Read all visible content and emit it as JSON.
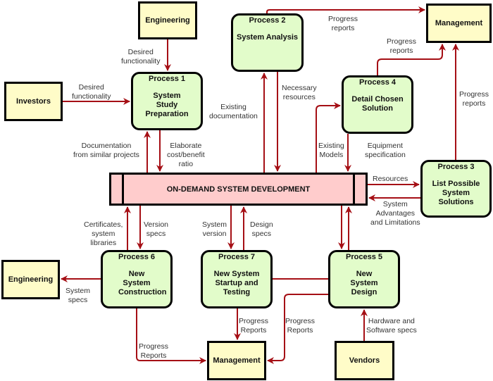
{
  "colors": {
    "flow": "#a50f15",
    "entity_fill": "#fffcc8",
    "process_fill": "#e2fcca",
    "store_fill": "#ffcccc",
    "border": "#000000"
  },
  "entities": {
    "engineering_top": "Engineering",
    "investors": "Investors",
    "management_top": "Management",
    "engineering_bottom": "Engineering",
    "management_bottom": "Management",
    "vendors": "Vendors"
  },
  "processes": {
    "p1": {
      "title": "Process 1",
      "name": "System Study Preparation"
    },
    "p2": {
      "title": "Process 2",
      "name": "System Analysis"
    },
    "p3": {
      "title": "Process 3",
      "name": "List Possible System Solutions"
    },
    "p4": {
      "title": "Process 4",
      "name": "Detail Chosen Solution"
    },
    "p5": {
      "title": "Process 5",
      "name": "New System Design"
    },
    "p6": {
      "title": "Process 6",
      "name": "New System Construction"
    },
    "p7": {
      "title": "Process 7",
      "name": "New System Startup and Testing"
    }
  },
  "store": {
    "name": "ON-DEMAND SYSTEM DEVELOPMENT"
  },
  "flows": {
    "eng_to_p1": [
      "Desired",
      "functionality"
    ],
    "inv_to_p1": [
      "Desired",
      "functionality"
    ],
    "store_to_p1": [
      "Documentation",
      "from similar projects"
    ],
    "p1_to_store": [
      "Elaborate",
      "cost/benefit",
      "ratio"
    ],
    "store_to_p2": [
      "Existing",
      "documentation"
    ],
    "p2_to_store": [
      "Necessary",
      "resources"
    ],
    "p2_to_mgmt": [
      "Progress",
      "reports"
    ],
    "p4_to_mgmt": [
      "Progress",
      "reports"
    ],
    "p3_to_mgmt": [
      "Progress",
      "reports"
    ],
    "store_to_p4": [
      "Existing",
      "Models"
    ],
    "p4_to_store": [
      "Equipment",
      "specification"
    ],
    "store_to_p3": [
      "Resources"
    ],
    "p3_to_store": [
      "System",
      "Advantages",
      "and Limitations"
    ],
    "p6_to_store": [
      "Certificates,",
      "system",
      "libraries"
    ],
    "store_to_p6": [
      "Version",
      "specs"
    ],
    "store_to_p7": [
      "System",
      "version"
    ],
    "p7_to_store": [
      "Design",
      "specs"
    ],
    "p6_to_eng": [
      "System",
      "specs"
    ],
    "p6_to_mgmt": [
      "Progress",
      "Reports"
    ],
    "p7_to_mgmt": [
      "Progress",
      "Reports"
    ],
    "p5_to_mgmt": [
      "Progress",
      "Reports"
    ],
    "vendors_to_p5": [
      "Hardware and",
      "Software specs"
    ]
  }
}
